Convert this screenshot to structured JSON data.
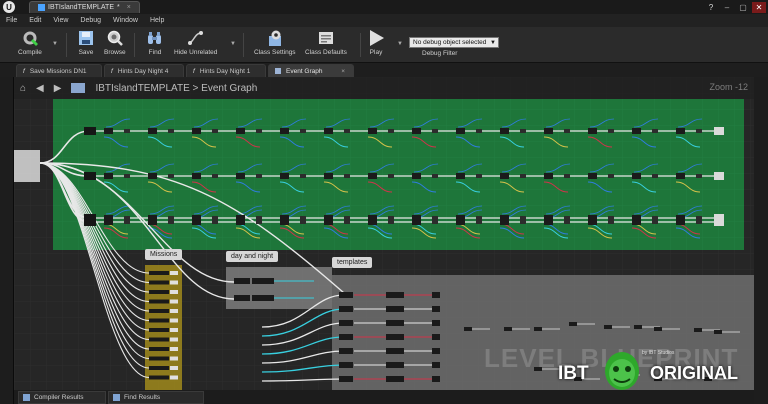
{
  "window": {
    "tab_title": "IBTIslandTEMPLATE",
    "tab_modified": "*",
    "help_icon": "?"
  },
  "menu": [
    "File",
    "Edit",
    "View",
    "Debug",
    "Window",
    "Help"
  ],
  "toolbar": {
    "compile": "Compile",
    "save": "Save",
    "browse": "Browse",
    "find": "Find",
    "hide_unrelated": "Hide Unrelated",
    "class_settings": "Class Settings",
    "class_defaults": "Class Defaults",
    "play": "Play",
    "debug_select": "No debug object selected",
    "debug_filter": "Debug Filter"
  },
  "graph_tabs": [
    {
      "label": "Save Missions DN1"
    },
    {
      "label": "Hints Day Night 4"
    },
    {
      "label": "Hints Day Night 1"
    },
    {
      "label": "Event Graph"
    }
  ],
  "graph": {
    "breadcrumb_root": "IBTIslandTEMPLATE",
    "breadcrumb_sep": ">",
    "breadcrumb_leaf": "Event Graph",
    "zoom": "Zoom -12",
    "comments": {
      "missions": "Missions",
      "day_night": "day and night",
      "templates": "templates"
    },
    "watermark": "LEVEL BLUEPRINT"
  },
  "bottom_tabs": [
    "Compiler Results",
    "Find Results"
  ],
  "logo": {
    "left": "IBT",
    "right": "ORIGINAL",
    "small": "by IBT Studios"
  },
  "colors": {
    "green_comment": "#1f7a3a",
    "yellow_comment": "#a08a1c",
    "wire_white": "#e8e8e8",
    "wire_blue": "#2f7de0",
    "wire_cyan": "#38d0e0",
    "wire_red": "#d0334a",
    "logo_green": "#2ea82b"
  }
}
